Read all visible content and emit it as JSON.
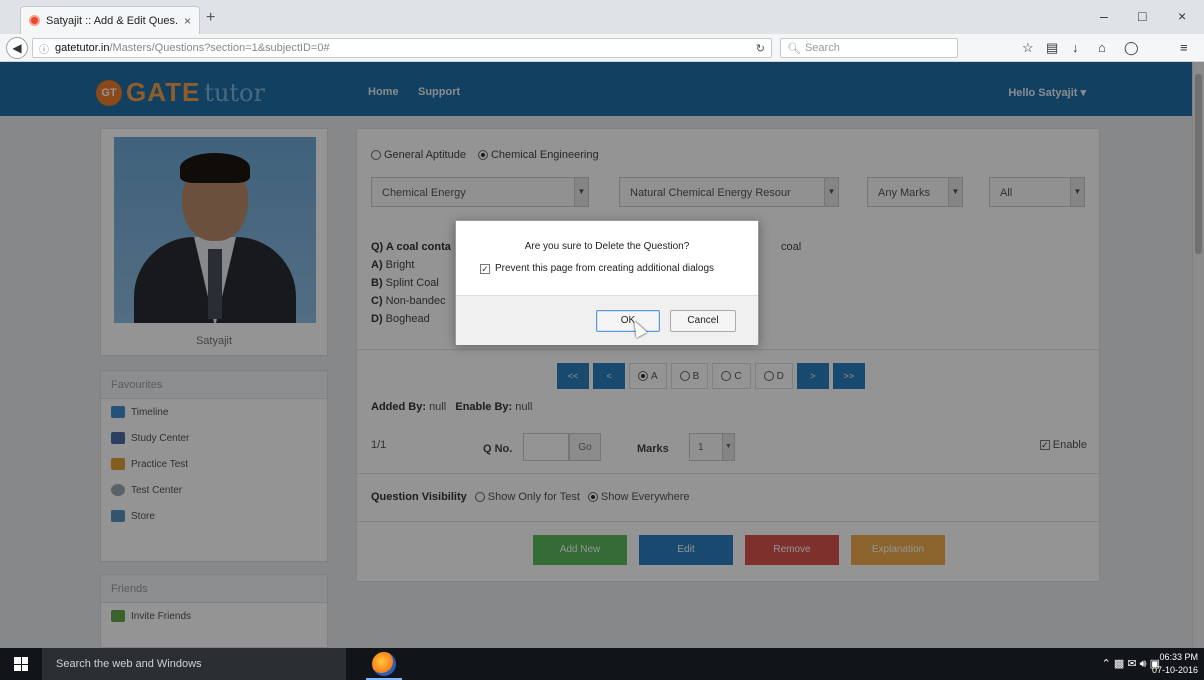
{
  "browser": {
    "tab_title": "Satyajit :: Add & Edit Ques...",
    "tab_close": "×",
    "new_tab": "+",
    "url_host": "gatetutor.in",
    "url_path": "/Masters/Questions?section=1&subjectID=0#",
    "search_placeholder": "Search",
    "minimize": "–",
    "maximize": "□",
    "close": "×"
  },
  "header": {
    "logo_badge": "GT",
    "logo_gate": "GATE",
    "logo_tutor": "tutor",
    "nav": [
      "Home",
      "Support"
    ],
    "user_menu": "Hello Satyajit ▾"
  },
  "profile": {
    "name": "Satyajit"
  },
  "favourites": {
    "heading": "Favourites",
    "items": [
      "Timeline",
      "Study Center",
      "Practice Test",
      "Test Center",
      "Store"
    ]
  },
  "friends": {
    "heading": "Friends",
    "items": [
      "Invite Friends"
    ]
  },
  "filters": {
    "subject_options": [
      "General Aptitude",
      "Chemical Engineering"
    ],
    "selected_subject": "Chemical Engineering",
    "topic": "Chemical Energy",
    "subtopic": "Natural Chemical Energy Resour",
    "marks": "Any Marks",
    "status": "All"
  },
  "question": {
    "text": "Q) A coal conta",
    "text_suffix": "coal",
    "options": [
      {
        "key": "A)",
        "text": "Bright"
      },
      {
        "key": "B)",
        "text": "Splint Coal"
      },
      {
        "key": "C)",
        "text": "Non-bandec"
      },
      {
        "key": "D)",
        "text": "Boghead"
      }
    ]
  },
  "pager": {
    "first": "<<",
    "prev": "<",
    "next": ">",
    "last": ">>",
    "answers": [
      "A",
      "B",
      "C",
      "D"
    ],
    "selected_answer": "A"
  },
  "meta": {
    "added_by_label": "Added By:",
    "added_by_value": "null",
    "enable_by_label": "Enable By:",
    "enable_by_value": "null",
    "count": "1/1",
    "qno_label": "Q No.",
    "go": "Go",
    "marks_label": "Marks",
    "marks_value": "1",
    "enable_label": "Enable"
  },
  "visibility": {
    "label": "Question Visibility",
    "options": [
      "Show Only for Test",
      "Show Everywhere"
    ],
    "selected": "Show Everywhere"
  },
  "actions": {
    "add_new": "Add New",
    "edit": "Edit",
    "remove": "Remove",
    "explanation": "Explanation"
  },
  "dialog": {
    "message": "Are you sure to Delete the Question?",
    "prevent": "Prevent this page from creating additional dialogs",
    "ok": "OK",
    "cancel": "Cancel"
  },
  "taskbar": {
    "search": "Search the web and Windows",
    "time": "06:33 PM",
    "date": "07-10-2016"
  },
  "colors": {
    "header": "#1f6ea6",
    "pager": "#2a7fbf",
    "add_new": "#5cb85c",
    "edit": "#2a7fbf",
    "remove": "#d9534f",
    "explanation": "#f0ad4e"
  }
}
